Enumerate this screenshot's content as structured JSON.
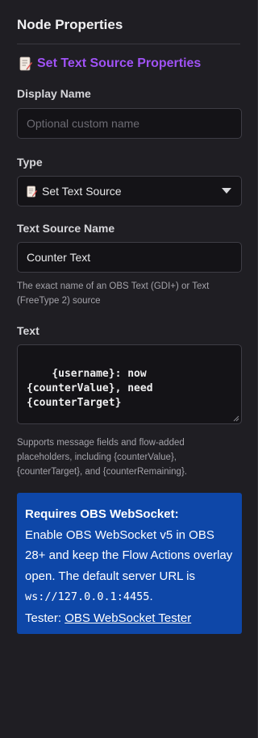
{
  "panel": {
    "title": "Node Properties",
    "node_type_label": "Set Text Source Properties",
    "node_icon": "memo-icon"
  },
  "display_name": {
    "label": "Display Name",
    "value": "",
    "placeholder": "Optional custom name"
  },
  "type": {
    "label": "Type",
    "selected": "Set Text Source",
    "icon": "memo-icon"
  },
  "text_source_name": {
    "label": "Text Source Name",
    "value": "Counter Text",
    "hint": "The exact name of an OBS Text (GDI+) or Text (FreeType 2) source"
  },
  "text": {
    "label": "Text",
    "value": "{username}: now {counterValue}, need {counterTarget}",
    "hint": "Supports message fields and flow-added placeholders, including {counterValue}, {counterTarget}, and {counterRemaining}."
  },
  "notice": {
    "title": "Requires OBS WebSocket:",
    "body_before_code": "Enable OBS WebSocket v5 in OBS 28+ and keep the Flow Actions overlay open. The default server URL is ",
    "code": "ws://127.0.0.1:4455",
    "body_after_code": ".",
    "tester_prefix": "Tester: ",
    "tester_link": "OBS WebSocket Tester",
    "background_color": "#0e47a8"
  },
  "colors": {
    "accent": "#a052f5",
    "background": "#1f1e23",
    "field_background": "#141317"
  }
}
